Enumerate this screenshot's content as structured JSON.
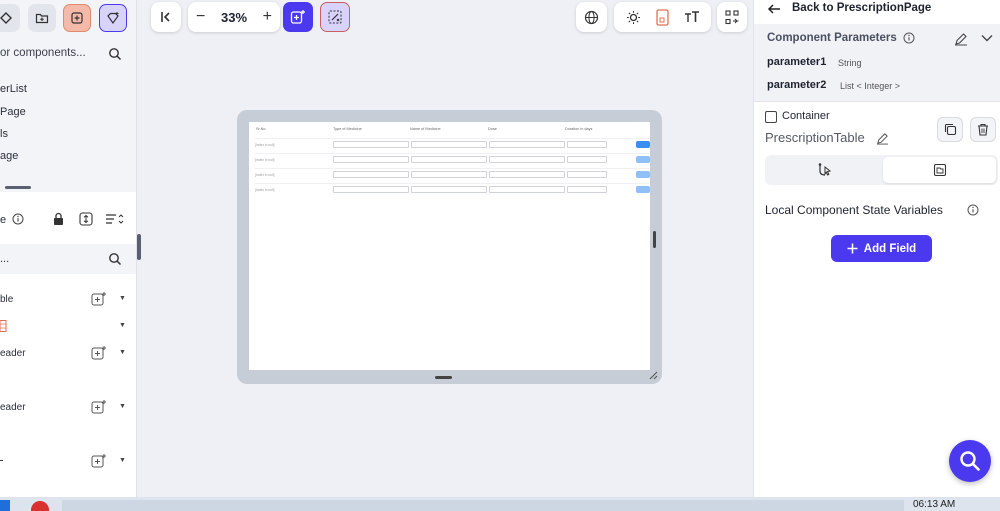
{
  "left_panel": {
    "search_placeholder": "or components...",
    "list_items": [
      "erList",
      "Page",
      "ls",
      "age"
    ],
    "props_label": "e",
    "search2_placeholder": "...",
    "tree_rows": [
      {
        "label": "ble",
        "has_add": true
      },
      {
        "label": "",
        "has_add": false
      },
      {
        "label": "eader",
        "has_add": true
      },
      {
        "label": "eader",
        "has_add": true
      },
      {
        "label": "",
        "has_add": true
      }
    ]
  },
  "toolbar": {
    "zoom_value": "33%",
    "zoom_minus": "−",
    "zoom_plus": "+"
  },
  "canvas": {
    "table_headers": [
      "Sr.No",
      "Type of Medicine",
      "Name of Medicine",
      "Dose",
      "Duration in days"
    ],
    "row_placeholder": "[Index in null]",
    "row_count": 4
  },
  "right_panel": {
    "back_label": "Back to PrescriptionPage",
    "params_title": "Component Parameters",
    "params": [
      {
        "name": "parameter1",
        "type": "String"
      },
      {
        "name": "parameter2",
        "type": "List < Integer >"
      }
    ],
    "container_label": "Container",
    "component_name": "PrescriptionTable",
    "state_title": "Local Component State Variables",
    "add_field_label": "Add Field"
  },
  "taskbar": {
    "time": "06:13 AM"
  },
  "colors": {
    "accent": "#4b39ef",
    "accent_light": "#d8d3fb",
    "orange_btn": "#f4b9a8",
    "canvas_bg": "#eef0f5"
  }
}
